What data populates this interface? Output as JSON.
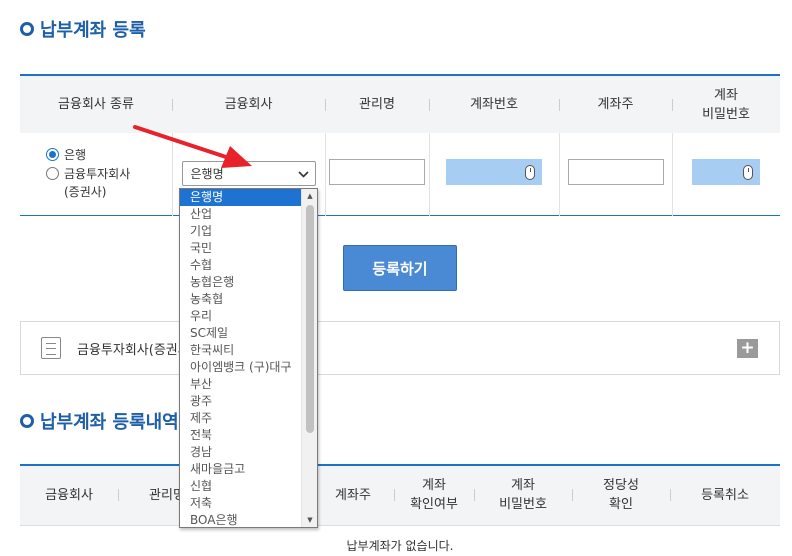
{
  "section1": {
    "title": "납부계좌 등록"
  },
  "reg_table": {
    "headers": [
      "금융회사 종류",
      "금융회사",
      "관리명",
      "계좌번호",
      "계좌주",
      "계좌\n비밀번호"
    ],
    "radio_bank": "은행",
    "radio_sec_line1": "금융투자회사",
    "radio_sec_line2": "(증권사)",
    "select_value": "은행명"
  },
  "register_button": "등록하기",
  "accordion": {
    "label": "금융투자회사(증권사)"
  },
  "section2": {
    "title": "납부계좌 등록내역"
  },
  "list_table": {
    "headers": [
      "금융회사",
      "관리명",
      "",
      "계좌주",
      "계좌\n확인여부",
      "계좌\n비밀번호",
      "정당성\n확인",
      "등록취소"
    ],
    "empty_text": "납부계좌가 없습니다."
  },
  "dropdown": {
    "options": [
      "은행명",
      "산업",
      "기업",
      "국민",
      "수협",
      "농협은행",
      "농축협",
      "우리",
      "SC제일",
      "한국씨티",
      "아이엠뱅크 (구)대구",
      "부산",
      "광주",
      "제주",
      "전북",
      "경남",
      "새마을금고",
      "신협",
      "저축",
      "BOA은행"
    ],
    "selected_index": 0
  },
  "colors": {
    "accent": "#1a73c8",
    "title": "#1f5fa8",
    "button": "#4a8ad4",
    "arrow": "#e8222b"
  }
}
